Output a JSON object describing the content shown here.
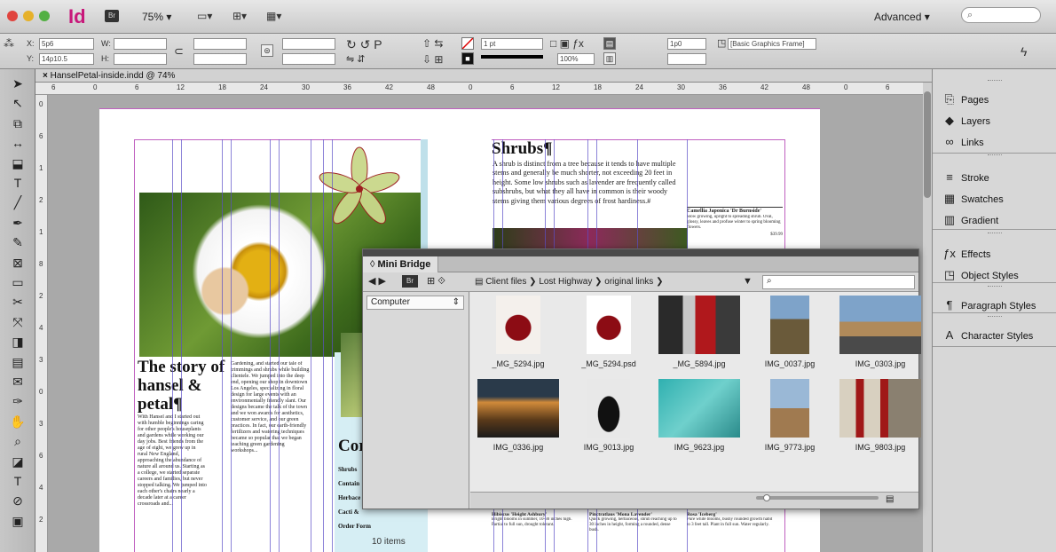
{
  "app": {
    "logo": "Id",
    "bridge_btn": "Br",
    "zoom": "75%",
    "workspace": "Advanced",
    "search_placeholder": "",
    "icons": [
      "window-close-icon",
      "window-minimize-icon",
      "window-zoom-icon",
      "view-options-icon",
      "screen-mode-icon",
      "arrange-documents-icon"
    ]
  },
  "control": {
    "x_label": "X:",
    "x_value": "5p6",
    "y_label": "Y:",
    "y_value": "14p10.5",
    "w_label": "W:",
    "h_label": "H:",
    "stroke_weight": "1 pt",
    "scale": "100%",
    "offset": "1p0",
    "object_style": "[Basic Graphics Frame]"
  },
  "document": {
    "tab_title": "HanselPetal-inside.indd @ 74%",
    "close": "×"
  },
  "ruler": {
    "h_ticks": [
      "6",
      "0",
      "6",
      "12",
      "18",
      "24",
      "30",
      "36",
      "42",
      "48",
      "0",
      "6",
      "12",
      "18",
      "24",
      "30",
      "36",
      "42",
      "48",
      "0",
      "6",
      "12"
    ],
    "v_ticks": [
      "0",
      "6",
      "1",
      "2",
      "1",
      "8",
      "2",
      "4",
      "3",
      "0",
      "3",
      "6",
      "4",
      "2"
    ]
  },
  "spread": {
    "left_heading": "The story of hansel & petal¶",
    "left_col1": "With Hansel and I started out with humble beginnings caring for other people's houseplants and gardens while working our day jobs. Best friends from the age of eight, we grew up in rural New England, approaching the abundance of nature all around us. Starting as a college, we started separate careers and families, but never stopped talking. We jumped into each other's chairs nearly a decade later at a career crossroads and...",
    "left_col2": "Gardening, and started our tale of trimmings and shrubs while building clientele. We jumped into the deep end, opening our shop in downtown Los Angeles, specializing in floral design for large events with an environmentally friendly slant. Our designs became the talk of the town and we won awards for aesthetics, customer service, and our green practices. In fact, our earth-friendly fertilizers and watering techniques became so popular that we began teaching green gardening workshops...",
    "right_heading": "Shrubs¶",
    "right_body": "A shrub is distinct from a tree because it tends to have multiple stems and generally be much shorter, not exceeding 20 feet in height. Some low shrubs such as lavender are frequently called subshrubs, but what they all have in common is their woody stems giving them various degrees of frost hardiness.#",
    "side_card": "Camellia Japonica 'Dr Burnside'",
    "side_card_body": "Slow growing, upright to spreading shrub. Oval, glossy, leaves and profuse winter to spring blooming flowers.",
    "side_card_price": "$39.99",
    "partial_heading": "Cor",
    "partial_items": [
      "Shrubs",
      "Contain",
      "Herbace",
      "Cacti &",
      "Order Form"
    ],
    "bottom_cards": [
      {
        "title": "Hibiscus 'Height Ashbury'",
        "body": "Bright blooms in summer, 10-30 inches high. Partial to full sun, drought tolerant."
      },
      {
        "title": "Pinctratlaus 'Mona Lavender'",
        "body": "Quick growing, herbaceous, shrub reaching up to 30 inches in height, forming a rounded, dense bush."
      },
      {
        "title": "Rosa 'Iceberg'",
        "body": "Pure white blooms, bushy rounded growth habit to 3 feet tall. Plant in full sun. Water regularly."
      }
    ]
  },
  "mini_bridge": {
    "tab": "Mini Bridge",
    "panel_icon": "mini-bridge-icon",
    "location": "Computer",
    "breadcrumb": [
      "Client files",
      "Lost Highway",
      "original links"
    ],
    "search_placeholder": "",
    "items": [
      {
        "name": "_MG_5294.jpg",
        "kind": "red-sphere"
      },
      {
        "name": "_MG_5294.psd",
        "kind": "red-sphere-cutout"
      },
      {
        "name": "_MG_5894.jpg",
        "kind": "red-machine"
      },
      {
        "name": "IMG_0037.jpg",
        "kind": "tall-sign"
      },
      {
        "name": "IMG_0303.jpg",
        "kind": "desert-road"
      },
      {
        "name": "IMG_0336.jpg",
        "kind": "sunset"
      },
      {
        "name": "IMG_9013.jpg",
        "kind": "silhouette"
      },
      {
        "name": "IMG_9623.jpg",
        "kind": "teal-wall"
      },
      {
        "name": "IMG_9773.jpg",
        "kind": "signpost"
      },
      {
        "name": "IMG_9803.jpg",
        "kind": "gas-pumps"
      }
    ],
    "count": "10 items",
    "colors": {
      "red": "#8c0c14",
      "teal": "#2fb0b0",
      "sky": "#7ea3c9",
      "sand": "#b08a5a"
    }
  },
  "panels": [
    {
      "label": "Pages",
      "icon": "pages-icon",
      "glyph": "⎘"
    },
    {
      "label": "Layers",
      "icon": "layers-icon",
      "glyph": "◆"
    },
    {
      "label": "Links",
      "icon": "links-icon",
      "glyph": "∞"
    },
    {
      "label": "Stroke",
      "icon": "stroke-icon",
      "glyph": "≡"
    },
    {
      "label": "Swatches",
      "icon": "swatches-icon",
      "glyph": "▦"
    },
    {
      "label": "Gradient",
      "icon": "gradient-icon",
      "glyph": "▥"
    },
    {
      "label": "Effects",
      "icon": "effects-icon",
      "glyph": "ƒx"
    },
    {
      "label": "Object Styles",
      "icon": "object-styles-icon",
      "glyph": "◳"
    },
    {
      "label": "Paragraph Styles",
      "icon": "paragraph-styles-icon",
      "glyph": "¶"
    },
    {
      "label": "Character Styles",
      "icon": "character-styles-icon",
      "glyph": "A"
    }
  ],
  "tools": [
    {
      "name": "selection-tool",
      "glyph": "➤"
    },
    {
      "name": "direct-selection-tool",
      "glyph": "↖"
    },
    {
      "name": "page-tool",
      "glyph": "⧉"
    },
    {
      "name": "gap-tool",
      "glyph": "↔"
    },
    {
      "name": "content-collector-tool",
      "glyph": "⬓"
    },
    {
      "name": "type-tool",
      "glyph": "T"
    },
    {
      "name": "line-tool",
      "glyph": "╱"
    },
    {
      "name": "pen-tool",
      "glyph": "✒"
    },
    {
      "name": "pencil-tool",
      "glyph": "✎"
    },
    {
      "name": "rectangle-frame-tool",
      "glyph": "⊠"
    },
    {
      "name": "rectangle-tool",
      "glyph": "▭"
    },
    {
      "name": "scissors-tool",
      "glyph": "✂"
    },
    {
      "name": "free-transform-tool",
      "glyph": "⤧"
    },
    {
      "name": "gradient-swatch-tool",
      "glyph": "◨"
    },
    {
      "name": "gradient-feather-tool",
      "glyph": "▤"
    },
    {
      "name": "note-tool",
      "glyph": "✉"
    },
    {
      "name": "eyedropper-tool",
      "glyph": "✑"
    },
    {
      "name": "hand-tool",
      "glyph": "✋"
    },
    {
      "name": "zoom-tool",
      "glyph": "⌕"
    },
    {
      "name": "fill-stroke-swatch",
      "glyph": "◪"
    },
    {
      "name": "formatting-container",
      "glyph": "T"
    },
    {
      "name": "apply-none",
      "glyph": "⊘"
    },
    {
      "name": "screen-mode",
      "glyph": "▣"
    }
  ]
}
